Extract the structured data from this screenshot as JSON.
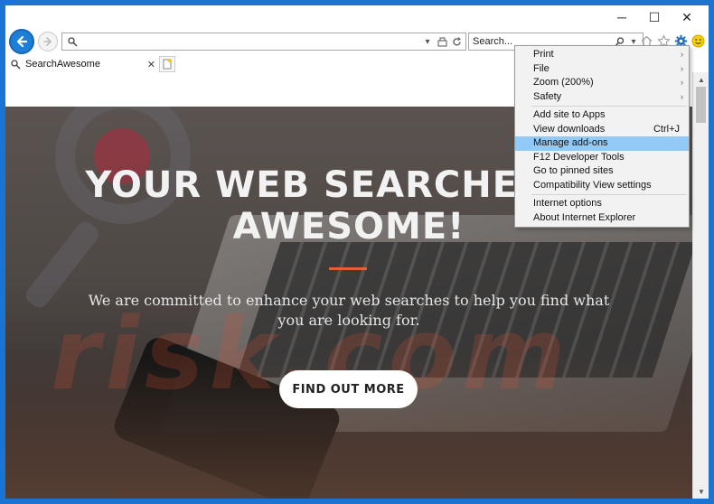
{
  "window": {
    "controls": [
      "─",
      "☐",
      "✕"
    ]
  },
  "address": {
    "value": "",
    "placeholder": ""
  },
  "search": {
    "placeholder": "Search..."
  },
  "tab": {
    "title": "SearchAwesome",
    "close": "✕"
  },
  "hero": {
    "title_line1": "YOUR WEB SEARCHES BE",
    "title_line2": "AWESOME!",
    "subtitle": "We are committed to enhance your web searches to help you find what you are looking for.",
    "cta": "FIND OUT MORE",
    "watermark": "risk.com"
  },
  "menu": {
    "items": [
      {
        "label": "Print",
        "arrow": "›"
      },
      {
        "label": "File",
        "arrow": "›"
      },
      {
        "label": "Zoom (200%)",
        "arrow": "›"
      },
      {
        "label": "Safety",
        "arrow": "›"
      },
      {
        "label": "Add site to Apps"
      },
      {
        "label": "View downloads",
        "shortcut": "Ctrl+J"
      },
      {
        "label": "Manage add-ons"
      },
      {
        "label": "F12 Developer Tools"
      },
      {
        "label": "Go to pinned sites"
      },
      {
        "label": "Compatibility View settings"
      },
      {
        "label": "Internet options"
      },
      {
        "label": "About Internet Explorer"
      }
    ]
  },
  "colors": {
    "frame": "#1b74d2",
    "menu_highlight": "#91c9f7",
    "accent_divider": "#e0603a"
  }
}
